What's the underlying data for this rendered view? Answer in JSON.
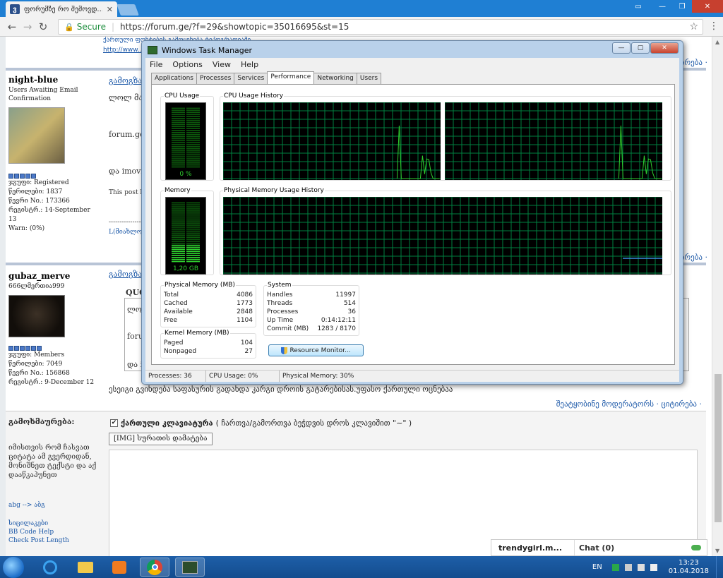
{
  "browser": {
    "tab_title": "ფორუმზე რო შემოვდ...",
    "tab_favicon": "ვ",
    "secure_text": "Secure",
    "url": "https://forum.ge/?f=29&showtopic=35016695&st=15"
  },
  "forum": {
    "top_lines": [
      "ქართული ფონტების გამოყენება ტიპოგრაფიაში",
      "http://www..."
    ],
    "quote_link": "ციტირება ·",
    "posts": [
      {
        "name": "night-blue",
        "subtitle": "Users Awaiting Email Confirmation",
        "stats": [
          "ჯგუფი: Registered",
          "წერილები: 1837",
          "წევრი No.: 173366",
          "რეგისტრ.: 14-September 13",
          "Warn: (0%)"
        ],
        "header": "გამოგზავ",
        "lines": [
          "ლოლ მართა",
          "forum.ge (",
          "და imovie",
          "This post ha",
          "--------------------",
          "L(მიახლოებ"
        ]
      },
      {
        "name": "gubaz_merve",
        "subtitle": "666ლმერთია999",
        "stats": [
          "ჯგუფი: Members",
          "წერილები: 7049",
          "წევრი No.: 156868",
          "რეგისტრ.: 9-December 12"
        ],
        "header": "გამოგზავ",
        "quote_label": "QUO",
        "lines": [
          "ლოლ",
          "forum",
          "და im"
        ]
      }
    ],
    "footer_text": "ესეიგი გვიხდება საფასურის გადახდა კარგი დროის გატარებისას.უფასო ქართული ოცნებაა",
    "moderation_link": "შეატყობინე მოდერატორს · ციტირება ·",
    "reply": {
      "title": "გამოხმაურება:",
      "help_text": "იმისთვის რომ ჩასვათ ციტატა ამ გვერდიდან, მონიშნეთ ტექსტი და აქ დააწკაპუნეთ",
      "help_link": "აქ დააწკაპუნეთ",
      "links": [
        "abg --> აბგ",
        "სიცილაკები",
        "BB Code Help",
        "Check Post Length"
      ],
      "keyboard_label": "ქართული კლავიატურა",
      "keyboard_note": "( ჩართვა/გამორთვა ბეჭდვის დროს კლავიშით \"~\" )",
      "img_button": "[IMG] სურათის დამატება"
    },
    "chat": {
      "user": "trendygirl.m...",
      "label": "Chat (0)"
    }
  },
  "task_manager": {
    "title": "Windows Task Manager",
    "menu": [
      "File",
      "Options",
      "View",
      "Help"
    ],
    "tabs": [
      "Applications",
      "Processes",
      "Services",
      "Performance",
      "Networking",
      "Users"
    ],
    "active_tab": "Performance",
    "cpu_usage_label": "CPU Usage",
    "cpu_usage_value": "0 %",
    "cpu_usage_fraction": 0.0,
    "cpu_history_label": "CPU Usage History",
    "memory_label": "Memory",
    "memory_value": "1,20 GB",
    "memory_fraction": 0.3,
    "memory_history_label": "Physical Memory Usage History",
    "physical_memory": {
      "title": "Physical Memory (MB)",
      "rows": [
        [
          "Total",
          "4086"
        ],
        [
          "Cached",
          "1773"
        ],
        [
          "Available",
          "2848"
        ],
        [
          "Free",
          "1104"
        ]
      ]
    },
    "kernel_memory": {
      "title": "Kernel Memory (MB)",
      "rows": [
        [
          "Paged",
          "104"
        ],
        [
          "Nonpaged",
          "27"
        ]
      ]
    },
    "system": {
      "title": "System",
      "rows": [
        [
          "Handles",
          "11997"
        ],
        [
          "Threads",
          "514"
        ],
        [
          "Processes",
          "36"
        ],
        [
          "Up Time",
          "0:14:12:11"
        ],
        [
          "Commit (MB)",
          "1283 / 8170"
        ]
      ]
    },
    "resource_button": "Resource Monitor...",
    "status": {
      "processes": "Processes: 36",
      "cpu": "CPU Usage: 0%",
      "memory": "Physical Memory: 30%"
    },
    "colors": {
      "graph_line": "#2fd12f",
      "grid": "#008040",
      "memory_line": "#3a8fe0"
    }
  },
  "taskbar": {
    "lang": "EN",
    "time": "13:23",
    "date": "01.04.2018"
  }
}
